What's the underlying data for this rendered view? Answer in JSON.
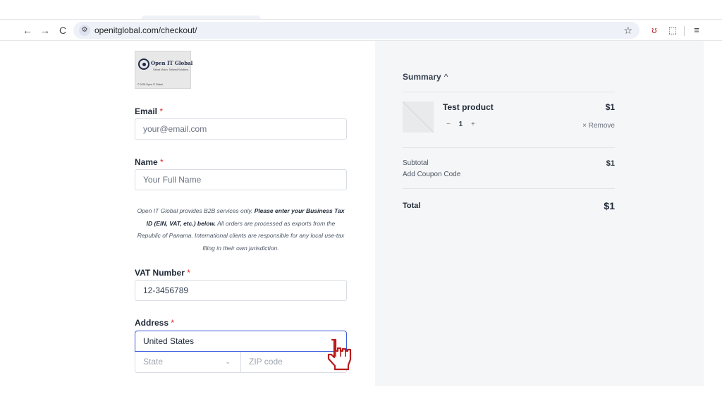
{
  "browser": {
    "url": "openitglobal.com/checkout/",
    "back_icon": "←",
    "forward_icon": "→",
    "reload_icon": "C",
    "site_info_icon": "⚙",
    "star_icon": "☆",
    "ext1_icon": "ʊ",
    "ext2_icon": "⬚",
    "menu_icon": "≡"
  },
  "logo": {
    "name": "Open IT Global",
    "tagline": "Global Vision. Tailored Solutions.",
    "copyright": "© 2025 Open IT Global"
  },
  "form": {
    "email": {
      "label": "Email",
      "required": "*",
      "placeholder": "your@email.com"
    },
    "name": {
      "label": "Name",
      "required": "*",
      "placeholder": "Your Full Name"
    },
    "notice": {
      "part1": "Open IT Global provides B2B services only.",
      "bold": "Please enter your Business Tax ID (EIN, VAT, etc.) below.",
      "part2": "All orders are processed as exports from the Republic of Panama. International clients are responsible for any local use-tax filing in their own jurisdiction."
    },
    "vat": {
      "label": "VAT Number",
      "required": "*",
      "value": "12-3456789"
    },
    "address": {
      "label": "Address",
      "required": "*",
      "country": "United States",
      "state_placeholder": "State",
      "state_chevron": "⌄",
      "zip_placeholder": "ZIP code"
    }
  },
  "summary": {
    "title": "Summary",
    "caret": "^",
    "product": {
      "name": "Test product",
      "price": "$1",
      "qty_minus": "−",
      "qty": "1",
      "qty_plus": "+",
      "remove": "× Remove"
    },
    "subtotal_label": "Subtotal",
    "subtotal_value": "$1",
    "coupon_label": "Add Coupon Code",
    "total_label": "Total",
    "total_value": "$1"
  },
  "colors": {
    "accent_focus": "#3b5bdb",
    "required": "#dc2626",
    "summary_bg": "#f5f6f7",
    "cursor": "#b91c1c"
  }
}
